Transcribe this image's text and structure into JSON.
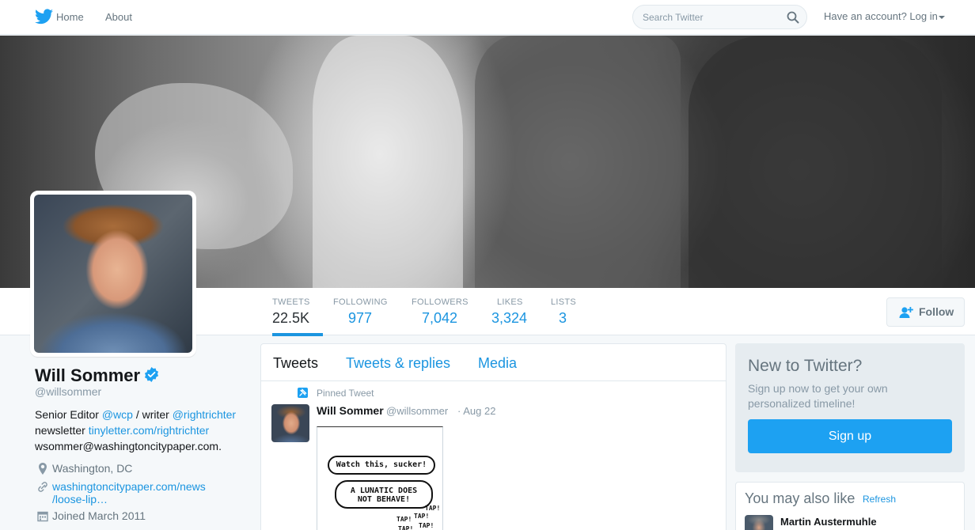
{
  "nav": {
    "home": "Home",
    "about": "About",
    "search_placeholder": "Search Twitter",
    "login": "Have an account? Log in"
  },
  "profile": {
    "name": "Will Sommer",
    "handle": "@willsommer",
    "bio": {
      "line1_prefix": "Senior Editor ",
      "line1_link1": "@wcp",
      "line1_middle": " / writer ",
      "line1_link2": "@rightrichter",
      "line2_prefix": "newsletter ",
      "line2_link": "tinyletter.com/rightrichter",
      "line3": "wsommer@washingtoncitypaper.com."
    },
    "location": "Washington, DC",
    "website_line1": "washingtoncitypaper.com/news",
    "website_line2": "/loose-lip…",
    "joined": "Joined March 2011",
    "verified": true
  },
  "stats": [
    {
      "label": "TWEETS",
      "value": "22.5K",
      "active": true
    },
    {
      "label": "FOLLOWING",
      "value": "977",
      "active": false
    },
    {
      "label": "FOLLOWERS",
      "value": "7,042",
      "active": false
    },
    {
      "label": "LIKES",
      "value": "3,324",
      "active": false
    },
    {
      "label": "LISTS",
      "value": "3",
      "active": false
    }
  ],
  "follow_button": "Follow",
  "tabs": [
    {
      "label": "Tweets",
      "active": true
    },
    {
      "label": "Tweets & replies",
      "active": false
    },
    {
      "label": "Media",
      "active": false
    }
  ],
  "pinned_tweet": {
    "pinned_label": "Pinned Tweet",
    "author": "Will Sommer",
    "handle": "@willsommer",
    "date": "· Aug 22",
    "comic": {
      "bubble1": "Watch this, sucker!",
      "bubble2_line1": "A LUNATIC DOES",
      "bubble2_line2": "NOT BEHAVE!",
      "sfx": "TAP!"
    }
  },
  "signup": {
    "title": "New to Twitter?",
    "subtitle": "Sign up now to get your own personalized timeline!",
    "button": "Sign up"
  },
  "suggestions": {
    "title": "You may also like",
    "refresh": "Refresh",
    "items": [
      {
        "name": "Martin Austermuhle"
      }
    ]
  },
  "colors": {
    "accent": "#1b95e0",
    "signup_button": "#1da1f2",
    "verified_badge": "#1da1f2"
  }
}
